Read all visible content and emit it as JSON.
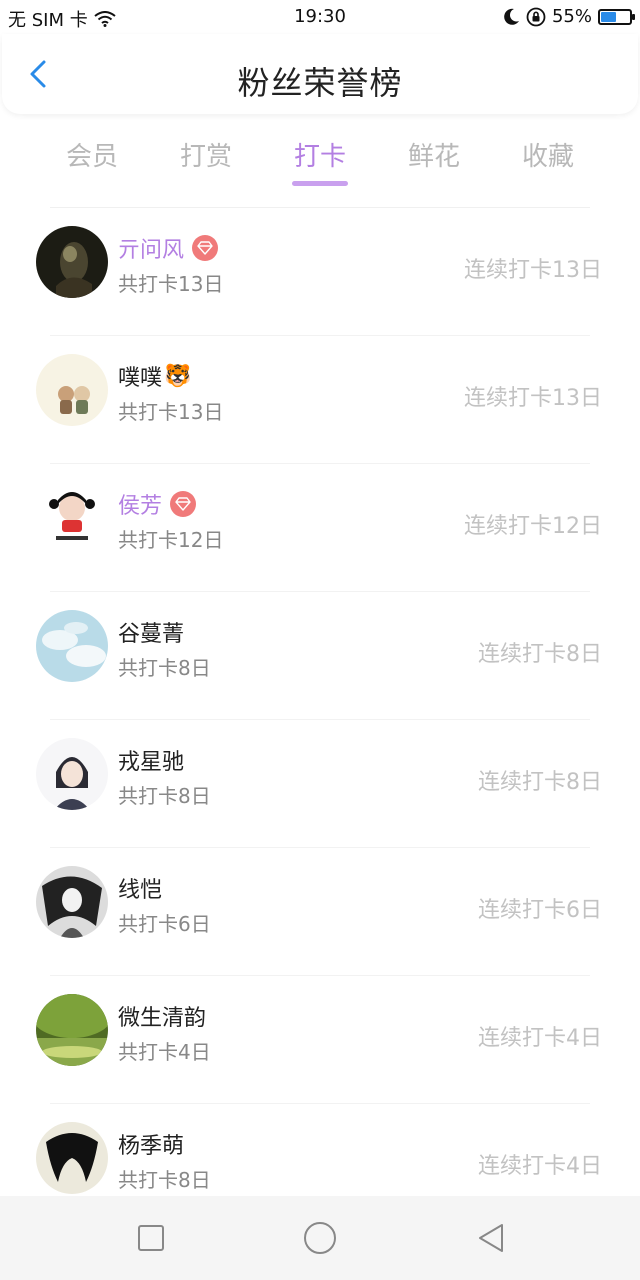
{
  "status_bar": {
    "carrier": "无 SIM 卡",
    "time": "19:30",
    "battery": "55%",
    "battery_level": 0.55,
    "icons": [
      "wifi-icon",
      "moon-icon",
      "rotation-lock-icon",
      "battery-icon"
    ]
  },
  "header": {
    "title": "粉丝荣誉榜",
    "back_icon": "chevron-left-icon"
  },
  "tabs": [
    {
      "label": "会员"
    },
    {
      "label": "打赏"
    },
    {
      "label": "打卡",
      "active": true
    },
    {
      "label": "鲜花"
    },
    {
      "label": "收藏"
    }
  ],
  "list": [
    {
      "name": "亓问风",
      "vip": true,
      "emoji": "",
      "total": "共打卡13日",
      "streak": "连续打卡13日"
    },
    {
      "name": "噗噗",
      "vip": false,
      "emoji": "🐯",
      "total": "共打卡13日",
      "streak": "连续打卡13日"
    },
    {
      "name": "侯芳",
      "vip": true,
      "emoji": "",
      "total": "共打卡12日",
      "streak": "连续打卡12日"
    },
    {
      "name": "谷蔓菁",
      "vip": false,
      "emoji": "",
      "total": "共打卡8日",
      "streak": "连续打卡8日"
    },
    {
      "name": "戎星驰",
      "vip": false,
      "emoji": "",
      "total": "共打卡8日",
      "streak": "连续打卡8日"
    },
    {
      "name": "线恺",
      "vip": false,
      "emoji": "",
      "total": "共打卡6日",
      "streak": "连续打卡6日"
    },
    {
      "name": "微生清韵",
      "vip": false,
      "emoji": "",
      "total": "共打卡4日",
      "streak": "连续打卡4日"
    },
    {
      "name": "杨季萌",
      "vip": false,
      "emoji": "",
      "total": "共打卡8日",
      "streak": "连续打卡4日"
    }
  ],
  "colors": {
    "accent": "#b37fe2",
    "vip_badge": "#f07a7a",
    "back_arrow": "#2a8be8",
    "muted": "#c2c2c2"
  },
  "nav_bar": {
    "icons": [
      "recent-apps-icon",
      "home-icon",
      "back-icon"
    ]
  }
}
